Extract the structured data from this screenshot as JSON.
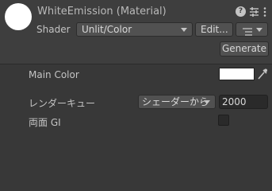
{
  "header": {
    "title": "WhiteEmission (Material)",
    "icons": {
      "help": "help-icon",
      "presets": "presets-icon",
      "more": "more-icon"
    },
    "help_glyph": "?"
  },
  "shader": {
    "label": "Shader",
    "selected": "Unlit/Color",
    "edit_label": "Edit...",
    "generate_label": "Generate"
  },
  "properties": {
    "main_color": {
      "label": "Main Color",
      "value": "#ffffff"
    },
    "render_queue": {
      "label": "レンダーキュー",
      "mode": "シェーダーから",
      "value": "2000"
    },
    "double_sided_gi": {
      "label": "両面 GI",
      "checked": false
    }
  }
}
